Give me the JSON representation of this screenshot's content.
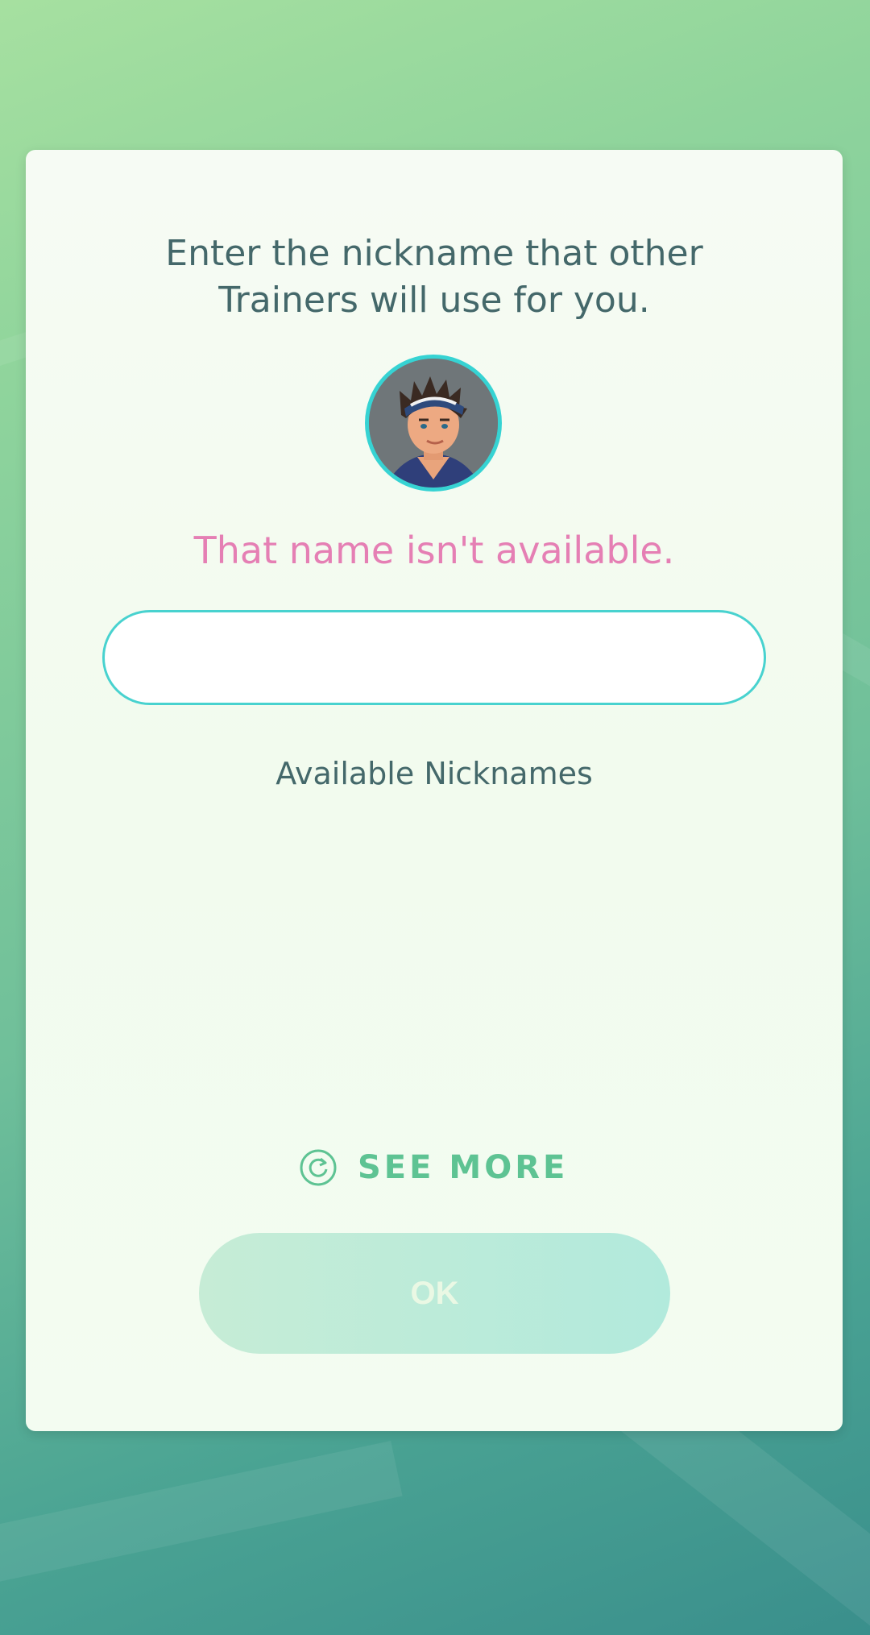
{
  "dialog": {
    "title": "Enter the nickname that other Trainers will use for you.",
    "error_message": "That name isn't available.",
    "nickname_input": {
      "value": "",
      "placeholder": ""
    },
    "available_heading": "Available Nicknames",
    "see_more_label": "SEE MORE",
    "see_more_icon": "refresh-icon",
    "ok_label": "OK",
    "ok_enabled": false
  },
  "colors": {
    "title_text": "#44686a",
    "error_text": "#e57fb4",
    "accent_teal": "#48d2cf",
    "see_more_text": "#5ec393",
    "ok_button_disabled": "#c6ecd6"
  },
  "avatar": {
    "icon": "trainer-avatar-icon"
  }
}
